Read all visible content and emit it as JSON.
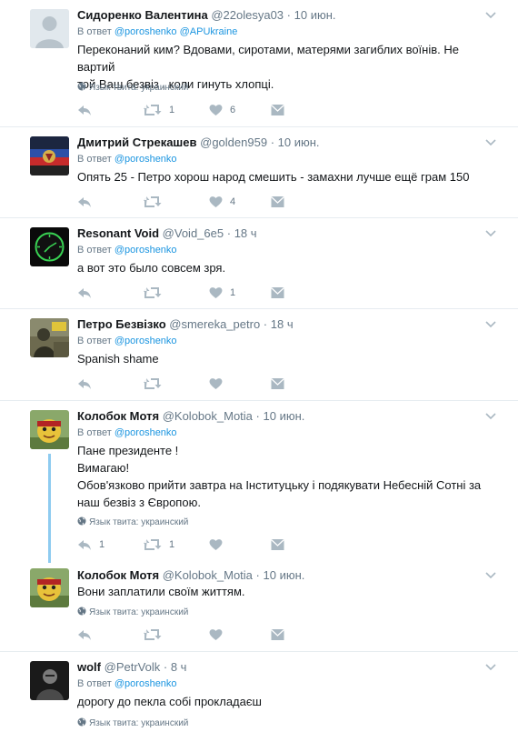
{
  "tweets": [
    {
      "name": "Сидоренко Валентина",
      "handle": "@22olesya03",
      "time": "10 июн.",
      "reply_prefix": "В ответ",
      "reply_to": [
        "@poroshenko",
        "@APUkraine"
      ],
      "text": [
        "Переконаний ким? Вдовами, сиротами, матерями загиблих воїнів. Не вартий",
        "той Ваш безвіз , коли гинуть хлопці."
      ],
      "lang": "Язык твита: украинский",
      "retweets": "1",
      "likes": "6"
    },
    {
      "name": "Дмитрий Стрекашев",
      "handle": "@golden959",
      "time": "10 июн.",
      "reply_prefix": "В ответ",
      "reply_to": [
        "@poroshenko"
      ],
      "text": [
        "Опять 25 - Петро хорош народ смешить - замахни лучше ещё грам 150"
      ],
      "retweets": "",
      "likes": "4"
    },
    {
      "name": "Resonant Void",
      "handle": "@Void_6e5",
      "time": "18 ч",
      "reply_prefix": "В ответ",
      "reply_to": [
        "@poroshenko"
      ],
      "text": [
        "а вот это было совсем зря."
      ],
      "retweets": "",
      "likes": "1"
    },
    {
      "name": "Петро Безвізко",
      "handle": "@smereka_petro",
      "time": "18 ч",
      "reply_prefix": "В ответ",
      "reply_to": [
        "@poroshenko"
      ],
      "text": [
        "Spanish shame"
      ],
      "retweets": "",
      "likes": ""
    },
    {
      "name": "Колобок Мотя",
      "handle": "@Kolobok_Motia",
      "time": "10 июн.",
      "reply_prefix": "В ответ",
      "reply_to": [
        "@poroshenko"
      ],
      "text": [
        "Пане президенте !",
        "Вимагаю!",
        "Обов'язково прийти завтра на Інституцьку і подякувати Небесній Сотні за",
        "наш безвіз з Європою."
      ],
      "lang": "Язык твита: украинский",
      "replies": "1",
      "retweets": "1",
      "likes": ""
    },
    {
      "name": "Колобок Мотя",
      "handle": "@Kolobok_Motia",
      "time": "10 июн.",
      "text": [
        "Вони заплатили своїм життям."
      ],
      "lang": "Язык твита: украинский",
      "retweets": "",
      "likes": ""
    },
    {
      "name": "wolf",
      "handle": "@PetrVolk",
      "time": "8 ч",
      "reply_prefix": "В ответ",
      "reply_to": [
        "@poroshenko"
      ],
      "text": [
        "дорогу до пекла собі прокладаєш"
      ],
      "lang": "Язык твита: украинский"
    }
  ],
  "colors": {
    "link": "#1b95e0",
    "muted": "#657786",
    "thread_line": "#8ecbf0",
    "divider": "#e6ecf0"
  },
  "icons": [
    "chevron-down-icon",
    "globe-icon",
    "reply-icon",
    "retweet-icon",
    "heart-icon",
    "direct-message-icon"
  ]
}
